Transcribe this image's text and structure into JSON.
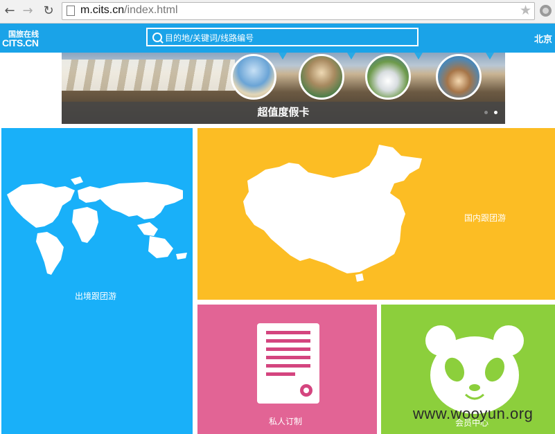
{
  "browser": {
    "url_host": "m.cits.cn",
    "url_path": "/index.html",
    "back_icon": "arrow-left-icon",
    "forward_icon": "arrow-right-icon",
    "reload_icon": "reload-icon",
    "star_icon": "star-icon",
    "globe_icon": "globe-icon"
  },
  "header": {
    "logo_line1": "国旅在线",
    "logo_line2": "CITS.CN",
    "search_placeholder": "目的地/关键词/线路编号",
    "city": "北京",
    "bg_color": "#1aa3e8"
  },
  "banner": {
    "title": "超值度假卡",
    "slide_count": 2,
    "active_slide": 2
  },
  "tiles": [
    {
      "label": "出境跟团游",
      "color": "#19b0f9",
      "icon": "world-map-icon"
    },
    {
      "label": "国内跟团游",
      "color": "#fcbd24",
      "icon": "china-map-icon"
    },
    {
      "label": "私人订制",
      "color": "#e26495",
      "icon": "document-icon"
    },
    {
      "label": "会员中心",
      "color": "#8ccf3c",
      "icon": "panda-icon"
    }
  ],
  "watermark": "www.wooyun.org"
}
